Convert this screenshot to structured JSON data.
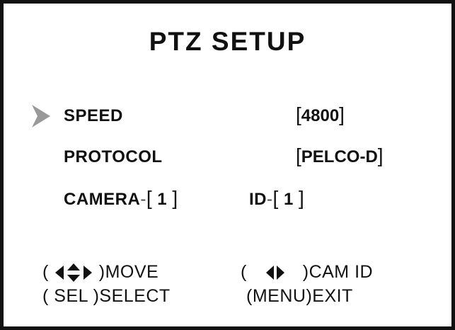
{
  "title": "PTZ SETUP",
  "menu": {
    "speed": {
      "label": "SPEED",
      "value": "4800"
    },
    "protocol": {
      "label": "PROTOCOL",
      "value": "PELCO-D"
    },
    "camera": {
      "label": "CAMERA",
      "value": "1",
      "id_label": "ID",
      "id_value": "1"
    }
  },
  "help": {
    "move": "MOVE",
    "cam_id": "CAM ID",
    "sel_key": "SEL",
    "select": "SELECT",
    "menu_key": "MENU",
    "exit": "EXIT"
  },
  "selected_item": "speed",
  "icons": [
    "selection-arrow-icon",
    "four-way-arrow-icon",
    "left-right-arrow-icon"
  ]
}
